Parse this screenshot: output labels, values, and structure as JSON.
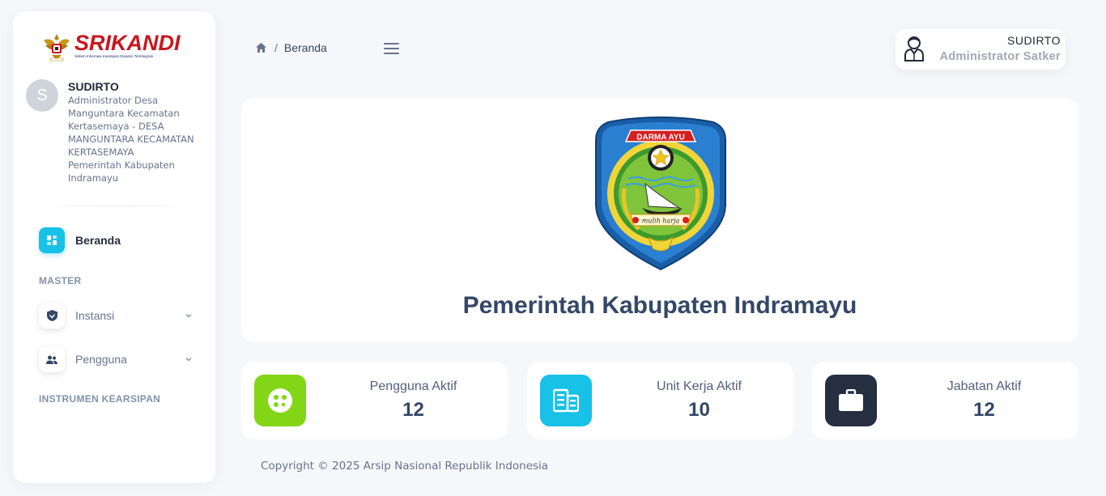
{
  "app": {
    "logo_title": "SRIKANDI",
    "logo_subtitle": "Sistem Informasi Kearsipan Dinamis Terintegrasi"
  },
  "user": {
    "initial": "S",
    "name": "SUDIRTO",
    "role_lines": [
      "Administrator Desa",
      "Manguntara Kecamatan",
      "Kertasemaya - DESA",
      "MANGUNTARA KECAMATAN",
      "KERTASEMAYA",
      "Pemerintah Kabupaten",
      "Indramayu"
    ]
  },
  "sidebar": {
    "home_label": "Beranda",
    "section_master": "MASTER",
    "instansi_label": "Instansi",
    "pengguna_label": "Pengguna",
    "section_instrumen": "INSTRUMEN KEARSIPAN"
  },
  "header": {
    "breadcrumb_sep": "/",
    "breadcrumb_current": "Beranda",
    "profile_name": "SUDIRTO",
    "profile_role": "Administrator Satker"
  },
  "main": {
    "emblem_banner": "DARMA AYU",
    "emblem_motto": "mulih harja",
    "title": "Pemerintah Kabupaten Indramayu"
  },
  "stats": [
    {
      "label": "Pengguna Aktif",
      "value": "12",
      "color": "#82d616"
    },
    {
      "label": "Unit Kerja Aktif",
      "value": "10",
      "color": "#17c1e8"
    },
    {
      "label": "Jabatan Aktif",
      "value": "12",
      "color": "#252f40"
    }
  ],
  "footer": {
    "text": "Copyright © 2025 Arsip Nasional Republik Indonesia"
  }
}
